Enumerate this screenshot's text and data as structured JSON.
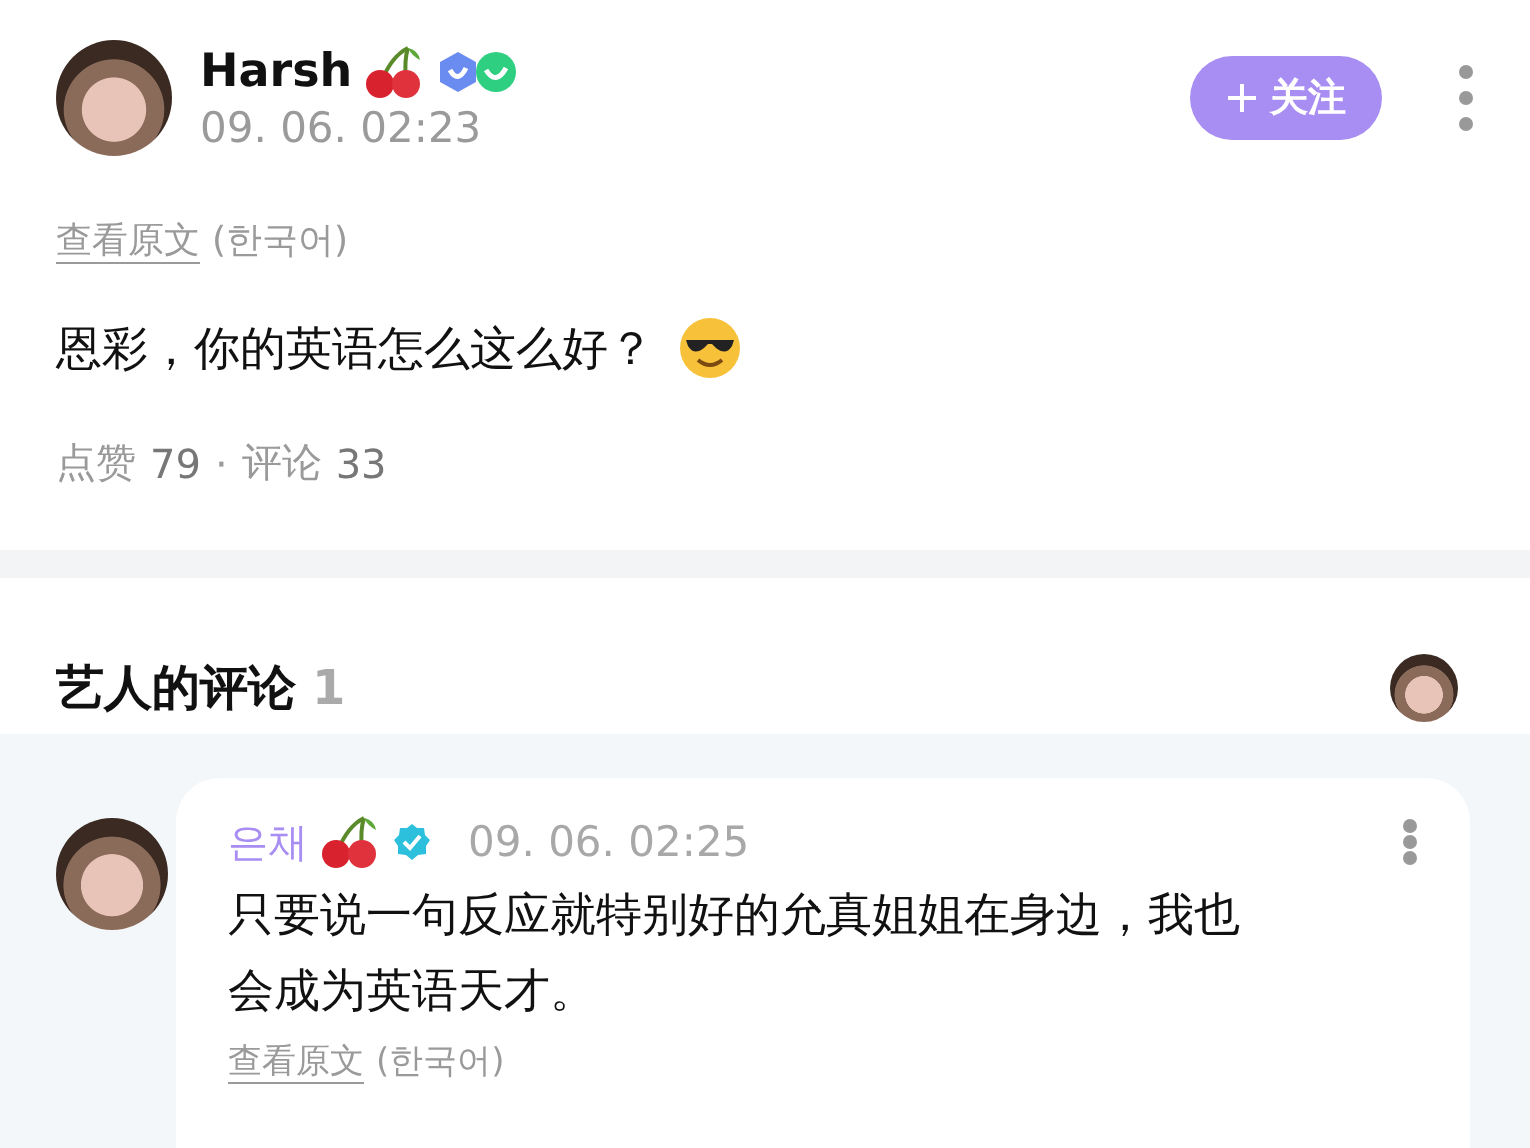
{
  "post": {
    "author": {
      "name": "Harsh",
      "time": "09. 06. 02:23"
    },
    "follow_button": {
      "label": "关注"
    },
    "translation": {
      "link": "查看原文",
      "language": "(한국어)"
    },
    "text": "恩彩，你的英语怎么这么好？",
    "stats": {
      "likes_label": "点赞",
      "likes": "79",
      "separator": "·",
      "comments_label": "评论",
      "comments": "33"
    }
  },
  "artist_comments": {
    "title": "艺人的评论",
    "count": "1",
    "comments": [
      {
        "author": "은채",
        "time": "09. 06. 02:25",
        "text": "只要说一句反应就特别好的允真姐姐在身边，我也会成为英语天才。",
        "translation": {
          "link": "查看原文",
          "language": "(한국어)"
        }
      }
    ]
  }
}
